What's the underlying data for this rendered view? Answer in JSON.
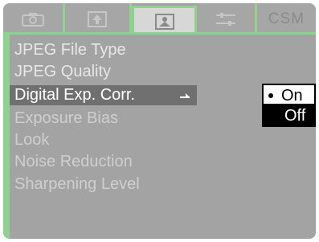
{
  "tabs": [
    {
      "icon": "camera-icon"
    },
    {
      "icon": "playback-icon"
    },
    {
      "icon": "shooting-menu-icon",
      "active": true
    },
    {
      "icon": "setup-icon"
    },
    {
      "label": "CSM",
      "icon": "csm-label"
    }
  ],
  "menu": {
    "items": [
      {
        "label": "JPEG File Type"
      },
      {
        "label": "JPEG Quality"
      },
      {
        "label": "Digital Exp. Corr."
      },
      {
        "label": "Exposure Bias"
      },
      {
        "label": "Look"
      },
      {
        "label": "Noise Reduction"
      },
      {
        "label": "Sharpening Level"
      }
    ],
    "selected_index": 2
  },
  "submenu": {
    "options": [
      {
        "label": "On",
        "checked": true
      },
      {
        "label": "Off",
        "highlighted": true
      }
    ]
  },
  "colors": {
    "screen_bg": "#a3a3a3",
    "accent_green": "#8fd28f",
    "selection": "#707070"
  }
}
